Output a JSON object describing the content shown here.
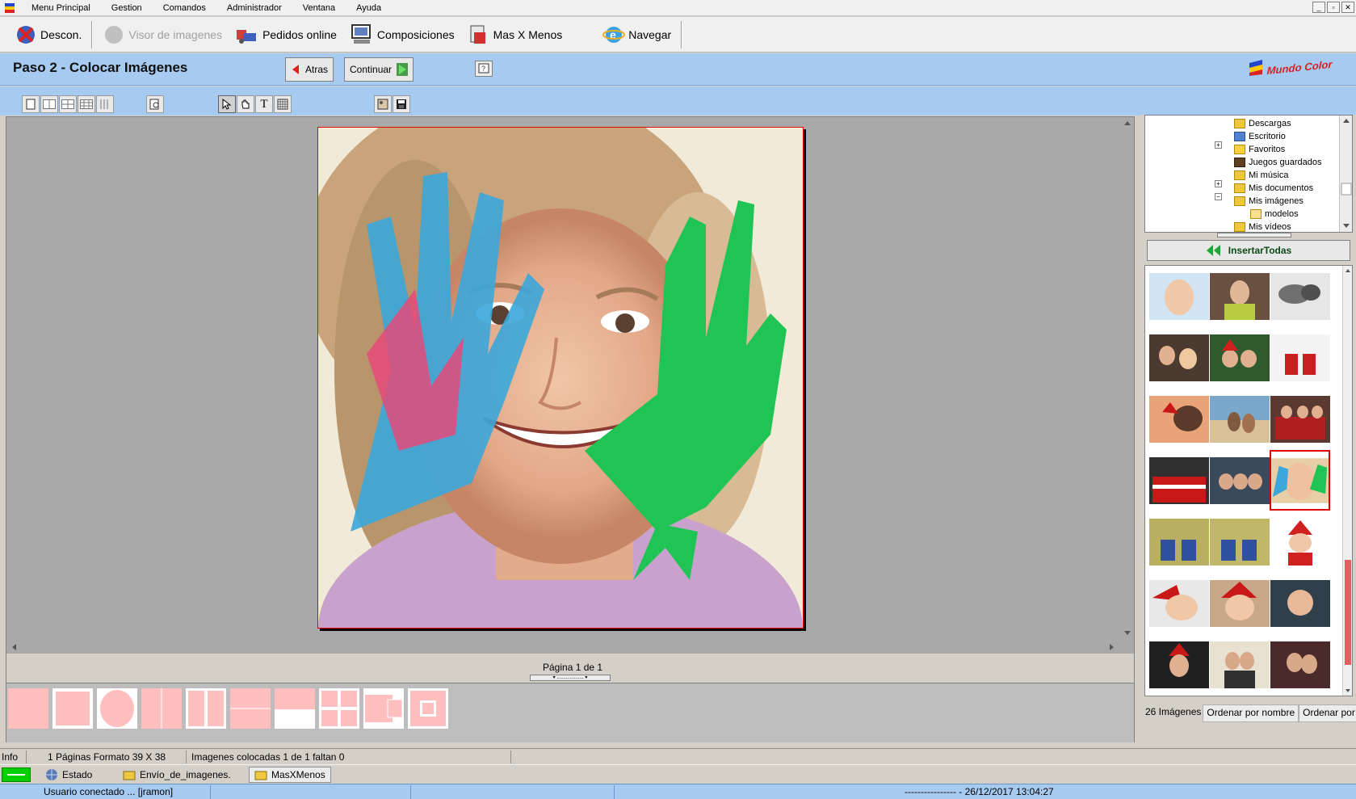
{
  "menubar": {
    "items": [
      "Menu Principal",
      "Gestion",
      "Comandos",
      "Administrador",
      "Ventana",
      "Ayuda"
    ]
  },
  "toolbar": {
    "descon_label": "Descon.",
    "visor_label": "Visor de imagenes",
    "pedidos_label": "Pedidos online",
    "composiciones_label": "Composiciones",
    "masxmenos_label": "Mas X Menos",
    "navegar_label": "Navegar"
  },
  "step": {
    "title": "Paso 2 - Colocar Imágenes",
    "back_label": "Atras",
    "continue_label": "Continuar",
    "brand_logo_text": "Mundo Color"
  },
  "page": {
    "label": "Página 1 de 1"
  },
  "folder_tree": {
    "items": [
      {
        "label": "Descargas",
        "expander": ""
      },
      {
        "label": "Escritorio",
        "expander": ""
      },
      {
        "label": "Favoritos",
        "expander": "+"
      },
      {
        "label": "Juegos guardados",
        "expander": ""
      },
      {
        "label": "Mi música",
        "expander": ""
      },
      {
        "label": "Mis documentos",
        "expander": "+"
      },
      {
        "label": "Mis imágenes",
        "expander": "−"
      },
      {
        "label": "modelos",
        "expander": ""
      },
      {
        "label": "Mis vídeos",
        "expander": ""
      }
    ]
  },
  "gallery": {
    "insert_all_label": "InsertarTodas",
    "count_label": "26 Imágenes",
    "sort_name_label": "Ordenar por nombre",
    "sort_date_label": "Ordenar por fecha"
  },
  "status": {
    "info_label": "Info",
    "pages_format": "1 Páginas Formato 39 X 38",
    "images_placed": "Imagenes colocadas 1 de 1 faltan 0"
  },
  "taskbar": {
    "estado_label": "Estado",
    "envio_label": "Envío_de_imagenes.",
    "masxmenos_label": "MasXMenos"
  },
  "footer": {
    "user_connected": "Usuario conectado ... [jramon]",
    "datetime": "---------------- - 26/12/2017 13:04:27"
  },
  "colors": {
    "accent_blue": "#a6caf0",
    "template_pink": "#ffbfbf",
    "selection_red": "#e00000",
    "insert_green": "#1aa83a"
  }
}
